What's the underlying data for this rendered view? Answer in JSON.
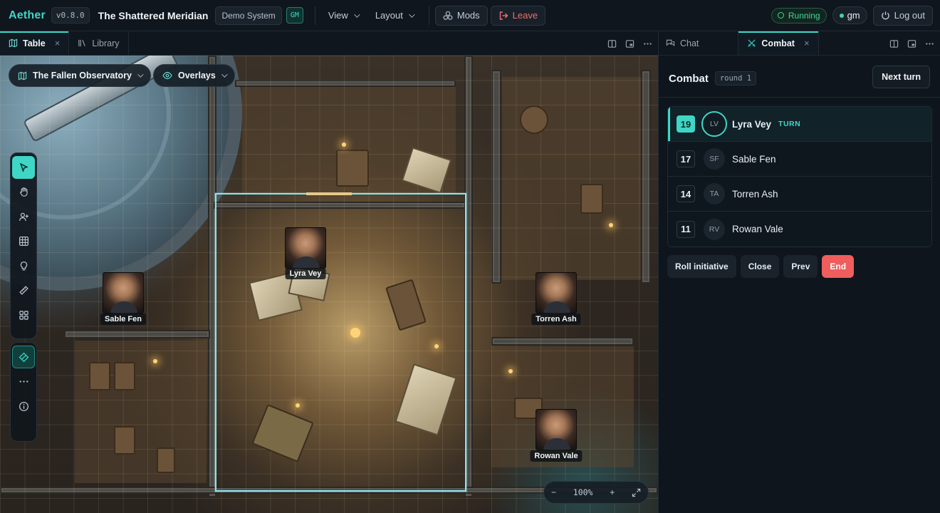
{
  "app": {
    "logo": "Aether",
    "version": "v0.8.0",
    "campaign_title": "The Shattered Meridian",
    "system": "Demo System",
    "role_badge": "GM"
  },
  "menu": {
    "view": "View",
    "layout": "Layout",
    "mods": "Mods",
    "leave": "Leave"
  },
  "status": {
    "running": "Running",
    "user": "gm",
    "logout": "Log out"
  },
  "left_tabs": [
    {
      "label": "Table",
      "active": true
    },
    {
      "label": "Library",
      "active": false
    }
  ],
  "scene": {
    "name": "The Fallen Observatory",
    "overlays": "Overlays",
    "zoom": "100%",
    "zoom_out": "−",
    "zoom_in": "+"
  },
  "tokens": [
    {
      "name": "Lyra Vey"
    },
    {
      "name": "Sable Fen"
    },
    {
      "name": "Torren Ash"
    },
    {
      "name": "Rowan Vale"
    }
  ],
  "tools": [
    "pointer-icon",
    "hand-icon",
    "add-user-icon",
    "grid-icon",
    "lightbulb-icon",
    "ruler-icon",
    "apps-icon",
    "pen-tool-icon",
    "more-icon",
    "info-icon"
  ],
  "right_tabs": [
    {
      "label": "Chat",
      "active": false
    },
    {
      "label": "Combat",
      "active": true
    }
  ],
  "combat": {
    "title": "Combat",
    "round": "round 1",
    "next_turn": "Next turn",
    "turn_badge": "TURN",
    "combatants": [
      {
        "init": "19",
        "initials": "LV",
        "name": "Lyra Vey",
        "current": true
      },
      {
        "init": "17",
        "initials": "SF",
        "name": "Sable Fen",
        "current": false
      },
      {
        "init": "14",
        "initials": "TA",
        "name": "Torren Ash",
        "current": false
      },
      {
        "init": "11",
        "initials": "RV",
        "name": "Rowan Vale",
        "current": false
      }
    ],
    "actions": {
      "roll": "Roll initiative",
      "close": "Close",
      "prev": "Prev",
      "end": "End"
    }
  },
  "colors": {
    "accent": "#3fd6c6",
    "danger": "#f05d5d",
    "running": "#3fd6a0"
  }
}
